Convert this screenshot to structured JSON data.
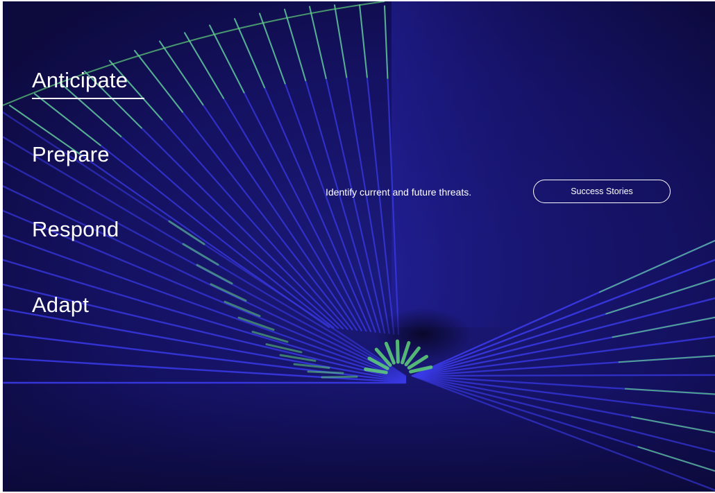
{
  "nav": {
    "items": [
      {
        "label": "Anticipate",
        "active": true
      },
      {
        "label": "Prepare",
        "active": false
      },
      {
        "label": "Respond",
        "active": false
      },
      {
        "label": "Adapt",
        "active": false
      }
    ]
  },
  "hero": {
    "tagline": "Identify current and future threats.",
    "cta_label": "Success Stories"
  },
  "colors": {
    "background": "#0f0c48",
    "line_blue": "#3a3ae8",
    "line_green": "#5fd27a",
    "text": "#ffffff"
  }
}
